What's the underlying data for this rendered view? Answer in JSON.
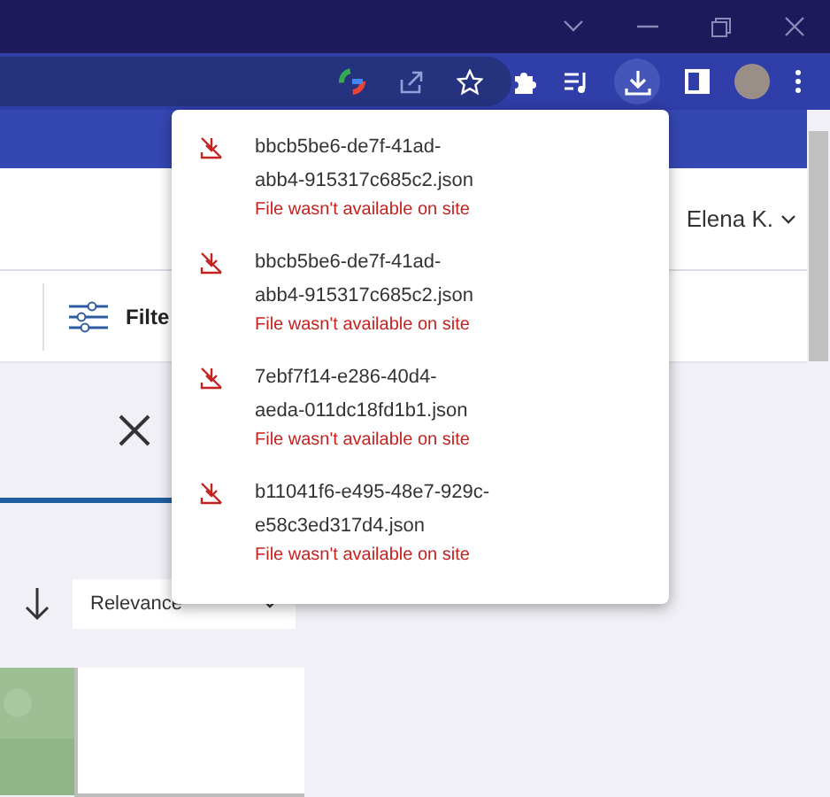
{
  "header": {
    "user_name": "Elena K."
  },
  "filter_bar": {
    "filter_label": "Filte"
  },
  "sort": {
    "value": "Relevance"
  },
  "downloads": [
    {
      "filename_lines": [
        "bbcb5be6-de7f-41ad-",
        "abb4-915317c685c2.json"
      ],
      "status": "File wasn't available on site",
      "failed": true
    },
    {
      "filename_lines": [
        "bbcb5be6-de7f-41ad-",
        "abb4-915317c685c2.json"
      ],
      "status": "File wasn't available on site",
      "failed": true
    },
    {
      "filename_lines": [
        "7ebf7f14-e286-40d4-",
        "aeda-011dc18fd1b1.json"
      ],
      "status": "File wasn't available on site",
      "failed": true
    },
    {
      "filename_lines": [
        "b11041f6-e495-48e7-929c-",
        "e58c3ed317d4.json"
      ],
      "status": "File wasn't available on site",
      "failed": true
    }
  ]
}
